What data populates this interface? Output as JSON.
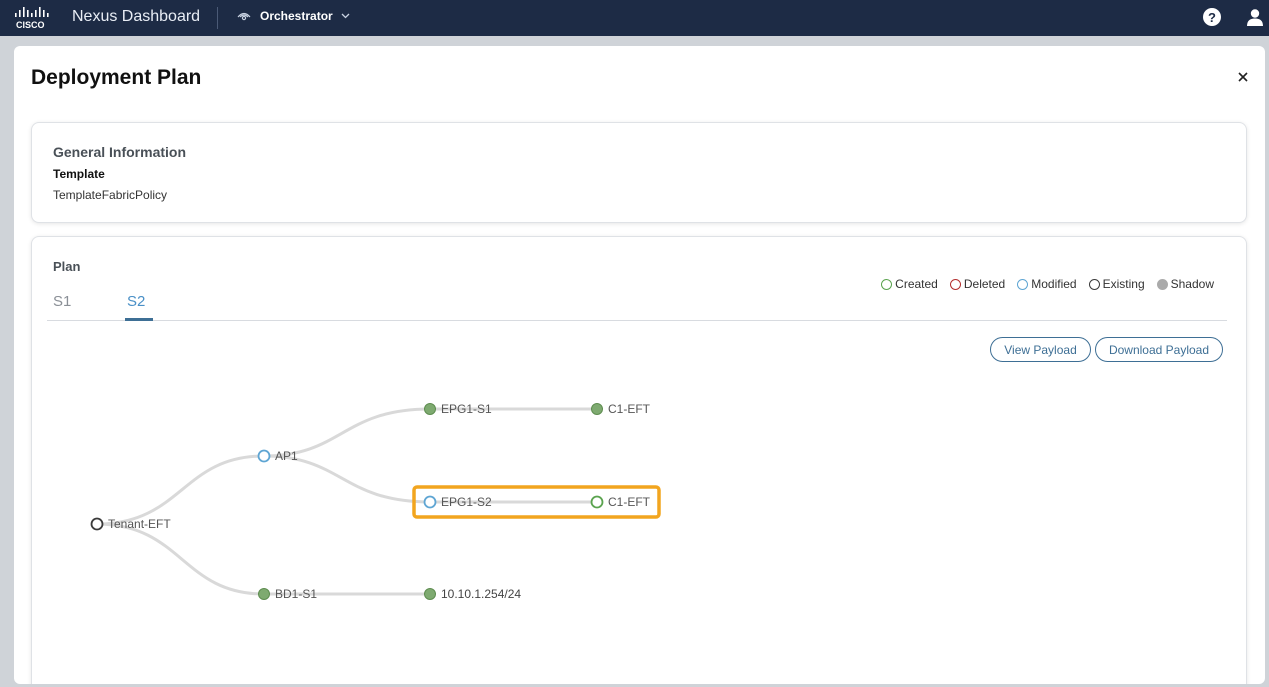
{
  "topbar": {
    "brand": "Nexus Dashboard",
    "service": "Orchestrator",
    "help_label": "?"
  },
  "modal": {
    "title": "Deployment Plan"
  },
  "general": {
    "heading": "General Information",
    "template_label": "Template",
    "template_value": "TemplateFabricPolicy"
  },
  "plan": {
    "heading": "Plan",
    "tabs": [
      {
        "label": "S1",
        "active": false
      },
      {
        "label": "S2",
        "active": true
      }
    ],
    "legend": [
      {
        "label": "Created",
        "color": "#5aa34e",
        "filled": false
      },
      {
        "label": "Deleted",
        "color": "#b32f2f",
        "filled": false
      },
      {
        "label": "Modified",
        "color": "#5ea5d3",
        "filled": false
      },
      {
        "label": "Existing",
        "color": "#3a3a3a",
        "filled": false
      },
      {
        "label": "Shadow",
        "color": "#aaaaaa",
        "filled": true
      }
    ],
    "view_payload": "View Payload",
    "download_payload": "Download Payload",
    "nodes": {
      "tenant": "Tenant-EFT",
      "ap": "AP1",
      "epg1": "EPG1-S1",
      "c1a": "C1-EFT",
      "epg2": "EPG1-S2",
      "c1b": "C1-EFT",
      "bd": "BD1-S1",
      "subnet": "10.10.1.254/24"
    },
    "highlight_color": "#f2a51f"
  }
}
